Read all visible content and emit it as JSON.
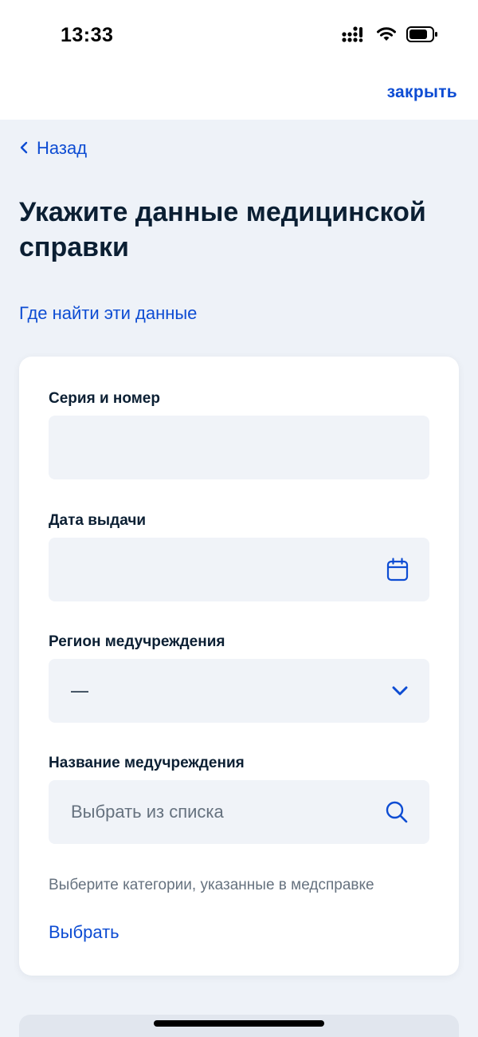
{
  "status_bar": {
    "time": "13:33",
    "icons": [
      "cellular-signal-icon",
      "wifi-icon",
      "battery-icon"
    ]
  },
  "header": {
    "close_label": "закрыть"
  },
  "nav": {
    "back_label": "Назад"
  },
  "page": {
    "title": "Укажите данные медицинской справки",
    "help_link": "Где найти эти данные"
  },
  "form": {
    "series_number": {
      "label": "Серия и номер",
      "value": ""
    },
    "issue_date": {
      "label": "Дата выдачи",
      "value": "",
      "icon": "calendar-icon"
    },
    "region": {
      "label": "Регион медучреждения",
      "value": "—",
      "icon": "chevron-down-icon"
    },
    "institution": {
      "label": "Название медучреждения",
      "placeholder": "Выбрать из списка",
      "icon": "search-icon"
    },
    "categories_hint": "Выберите категории, указанные в медсправке",
    "choose_label": "Выбрать"
  },
  "colors": {
    "accent": "#0d4cd3",
    "text": "#0b1f33",
    "muted": "#66727f",
    "field_bg": "#f0f3f8",
    "page_bg": "#eef2f8"
  }
}
